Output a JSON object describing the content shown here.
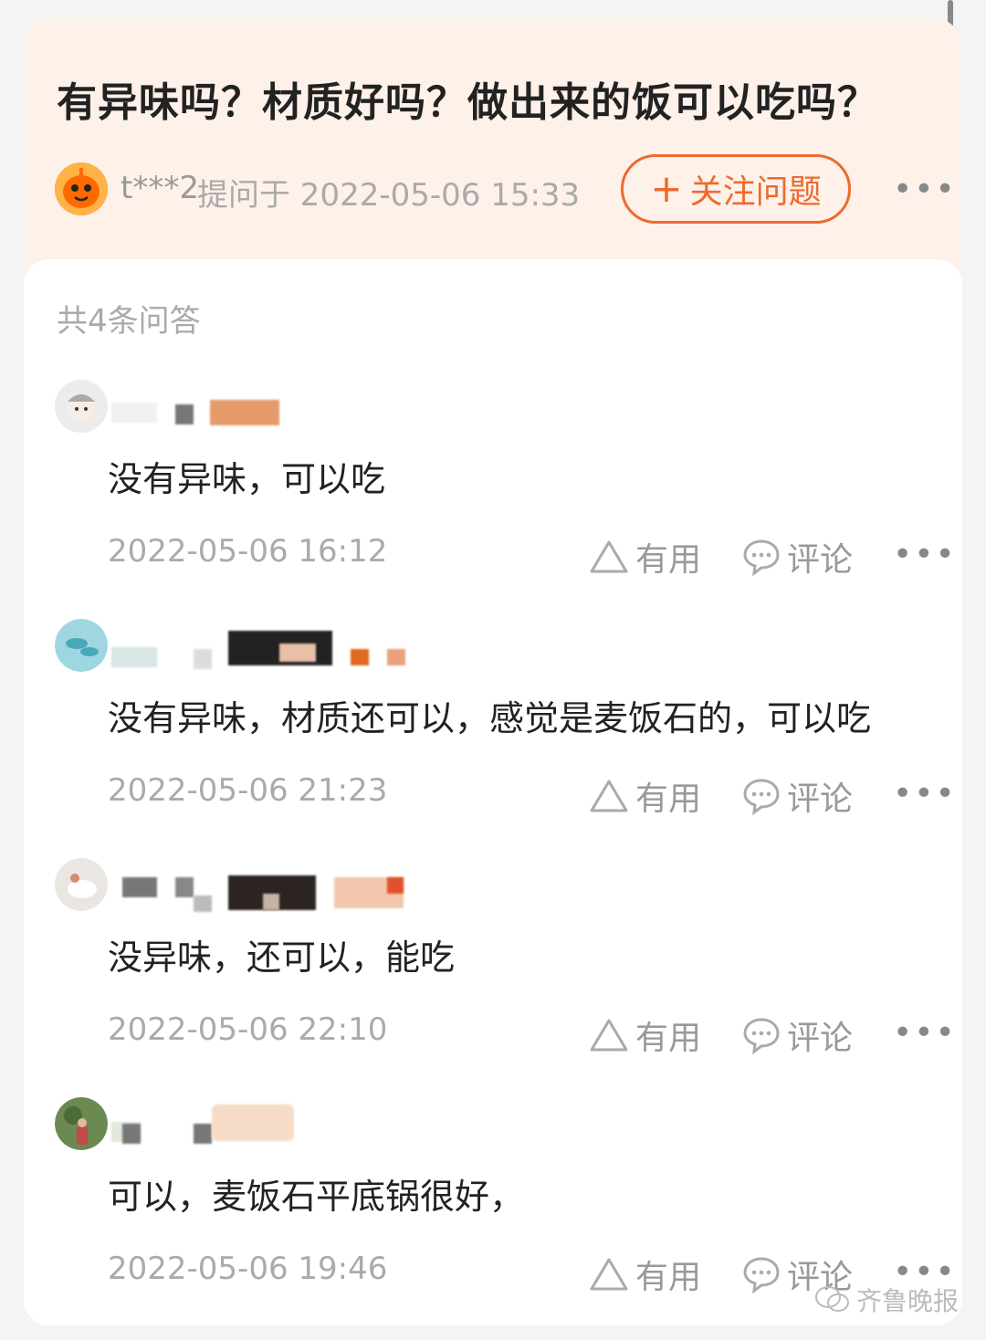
{
  "question": {
    "title": "有异味吗？材质好吗？做出来的饭可以吃吗？",
    "asker_name": "t***2",
    "asked_meta": "提问于 2022-05-06 15:33",
    "follow_label": "关注问题",
    "follow_icon": "plus-icon"
  },
  "answers_count_label": "共4条问答",
  "answers": [
    {
      "text": "没有异味，可以吃",
      "time": "2022-05-06 16:12",
      "useful_label": "有用",
      "comment_label": "评论"
    },
    {
      "text": "没有异味，材质还可以，感觉是麦饭石的，可以吃",
      "time": "2022-05-06 21:23",
      "useful_label": "有用",
      "comment_label": "评论"
    },
    {
      "text": "没异味，还可以，能吃",
      "time": "2022-05-06 22:10",
      "useful_label": "有用",
      "comment_label": "评论"
    },
    {
      "text": "可以，麦饭石平底锅很好，",
      "time": "2022-05-06 19:46",
      "useful_label": "有用",
      "comment_label": "评论"
    }
  ],
  "watermark": "齐鲁晚报",
  "colors": {
    "accent": "#ee6a2c",
    "header_bg": "#fdf1ea",
    "muted_text": "#aaaaaa"
  }
}
